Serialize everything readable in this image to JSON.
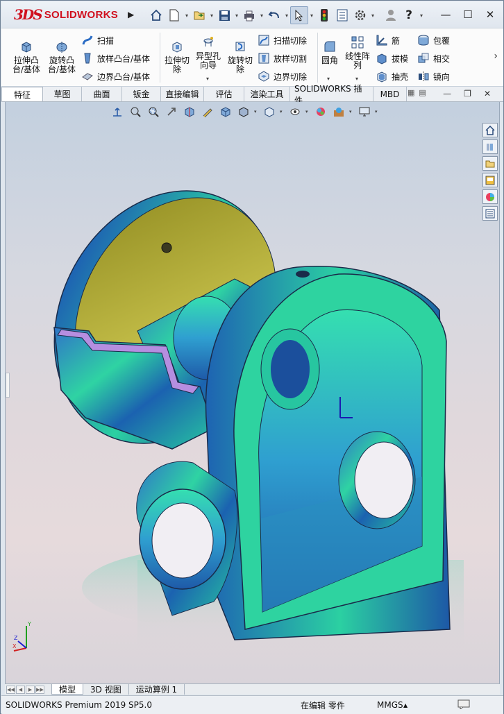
{
  "app": {
    "brand": "SOLIDWORKS",
    "logo_mark": "3DS"
  },
  "title_bar": {
    "quick_access": [
      "home-icon",
      "new-document-icon",
      "open-icon",
      "save-icon",
      "print-icon",
      "undo-icon",
      "select-cursor-icon",
      "rebuild-light-icon",
      "file-properties-icon",
      "options-gear-icon",
      "user-icon",
      "help-icon"
    ],
    "window_controls": [
      "minimize",
      "maximize",
      "close"
    ]
  },
  "ribbon": {
    "group1": {
      "extrude_boss": "拉伸凸\n台/基体",
      "revolve_boss": "旋转凸\n台/基体",
      "sweep": "扫描",
      "loft_boss": "放样凸台/基体",
      "boundary_boss": "边界凸台/基体"
    },
    "group2": {
      "extrude_cut": "拉伸切\n除",
      "hole_wizard": "异型孔\n向导",
      "revolve_cut": "旋转切\n除",
      "swept_cut": "扫描切除",
      "lofted_cut": "放样切割",
      "boundary_cut": "边界切除"
    },
    "group3": {
      "fillet": "圆角",
      "linear_pattern": "线性阵\n列",
      "rib": "筋",
      "draft": "拔模",
      "shell": "抽壳",
      "wrap": "包覆",
      "intersect": "相交",
      "mirror": "镜向"
    }
  },
  "tabs": [
    {
      "label": "特征",
      "active": true
    },
    {
      "label": "草图",
      "active": false
    },
    {
      "label": "曲面",
      "active": false
    },
    {
      "label": "钣金",
      "active": false
    },
    {
      "label": "直接编辑",
      "active": false
    },
    {
      "label": "评估",
      "active": false
    },
    {
      "label": "渲染工具",
      "active": false
    },
    {
      "label": "SOLIDWORKS 插件",
      "active": false
    },
    {
      "label": "MBD",
      "active": false
    }
  ],
  "bottom_tabs": [
    {
      "label": "模型",
      "active": true
    },
    {
      "label": "3D 视图",
      "active": false
    },
    {
      "label": "运动算例 1",
      "active": false
    }
  ],
  "status": {
    "product": "SOLIDWORKS Premium 2019 SP5.0",
    "mode": "在编辑 零件",
    "units": "MMGS",
    "units_caret": "▲"
  },
  "colors": {
    "accent_red": "#d0101e",
    "part_face_teal": "#2ed3a0",
    "part_edge_blue": "#1f5fa8",
    "section_face_purple": "#b58ee0",
    "flange_olive": "#b6b038"
  }
}
